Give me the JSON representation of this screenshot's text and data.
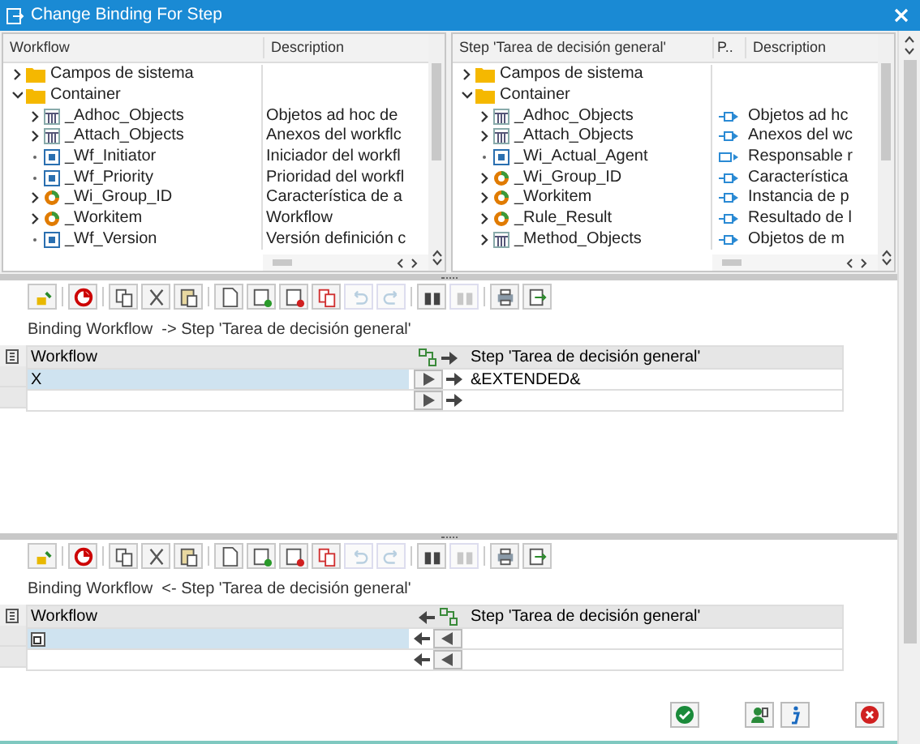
{
  "window": {
    "title": "Change Binding For Step"
  },
  "left_tree": {
    "columns": [
      "Workflow",
      "Description"
    ],
    "items": [
      {
        "label": "Campos de sistema",
        "kind": "folder",
        "expanded": false
      },
      {
        "label": "Container",
        "kind": "folder",
        "expanded": true,
        "children": [
          {
            "label": "_Adhoc_Objects",
            "kind": "table",
            "expanded": false,
            "description": "Objetos ad hoc de"
          },
          {
            "label": "_Attach_Objects",
            "kind": "table",
            "expanded": false,
            "description": "Anexos del workflc"
          },
          {
            "label": "_Wf_Initiator",
            "kind": "element",
            "description": "Iniciador del workfl"
          },
          {
            "label": "_Wf_Priority",
            "kind": "element",
            "description": "Prioridad del workfl"
          },
          {
            "label": "_Wi_Group_ID",
            "kind": "object",
            "expanded": false,
            "description": "Característica de a"
          },
          {
            "label": "_Workitem",
            "kind": "object",
            "expanded": false,
            "description": "Workflow"
          },
          {
            "label": "_Wf_Version",
            "kind": "element",
            "description": "Versión definición c"
          }
        ]
      }
    ]
  },
  "right_tree": {
    "columns": [
      "Step 'Tarea de decisión general'",
      "P..",
      "Description"
    ],
    "items": [
      {
        "label": "Campos de sistema",
        "kind": "folder",
        "expanded": false
      },
      {
        "label": "Container",
        "kind": "folder",
        "expanded": true,
        "children": [
          {
            "label": "_Adhoc_Objects",
            "kind": "table",
            "expanded": false,
            "export": false,
            "description": "Objetos ad hc"
          },
          {
            "label": "_Attach_Objects",
            "kind": "table",
            "expanded": false,
            "export": false,
            "description": "Anexos del wc"
          },
          {
            "label": "_Wi_Actual_Agent",
            "kind": "element",
            "export": true,
            "description": "Responsable r"
          },
          {
            "label": "_Wi_Group_ID",
            "kind": "object",
            "expanded": false,
            "export": false,
            "description": "Característica"
          },
          {
            "label": "_Workitem",
            "kind": "object",
            "expanded": false,
            "export": false,
            "description": "Instancia de p"
          },
          {
            "label": "_Rule_Result",
            "kind": "object",
            "expanded": false,
            "export": false,
            "description": "Resultado de l"
          },
          {
            "label": "_Method_Objects",
            "kind": "table",
            "expanded": false,
            "export": false,
            "description": "Objetos de m"
          }
        ]
      }
    ]
  },
  "bindings": [
    {
      "kind": "forward",
      "caption": "Binding Workflow  -> Step 'Tarea de decisión general'",
      "columns": [
        "Workflow",
        "Step 'Tarea de decisión general'"
      ],
      "rows": [
        {
          "selected": true,
          "workflow": "X",
          "step": "&EXTENDED&"
        },
        {
          "selected": false
        }
      ]
    },
    {
      "kind": "backward",
      "caption": "Binding Workflow  <- Step 'Tarea de decisión general'",
      "columns": [
        "Workflow",
        "Step 'Tarea de decisión general'"
      ],
      "rows": [
        {
          "selected": true,
          "help": true
        },
        {
          "selected": false,
          "help": false
        }
      ]
    }
  ],
  "toolbar": [
    {
      "kind": "select",
      "disabled": false
    },
    {
      "kind": "sep"
    },
    {
      "kind": "check",
      "disabled": false
    },
    {
      "kind": "sep"
    },
    {
      "kind": "copy",
      "disabled": false
    },
    {
      "kind": "cut",
      "disabled": false
    },
    {
      "kind": "paste",
      "disabled": false
    },
    {
      "kind": "sep"
    },
    {
      "kind": "new",
      "disabled": false
    },
    {
      "kind": "insert",
      "disabled": false
    },
    {
      "kind": "delete",
      "disabled": false
    },
    {
      "kind": "duplicate",
      "disabled": false
    },
    {
      "kind": "undo",
      "disabled": true
    },
    {
      "kind": "redo",
      "disabled": true
    },
    {
      "kind": "sep"
    },
    {
      "kind": "find",
      "disabled": false
    },
    {
      "kind": "findnext",
      "disabled": true
    },
    {
      "kind": "sep"
    },
    {
      "kind": "print",
      "disabled": false
    },
    {
      "kind": "export",
      "disabled": false
    }
  ]
}
